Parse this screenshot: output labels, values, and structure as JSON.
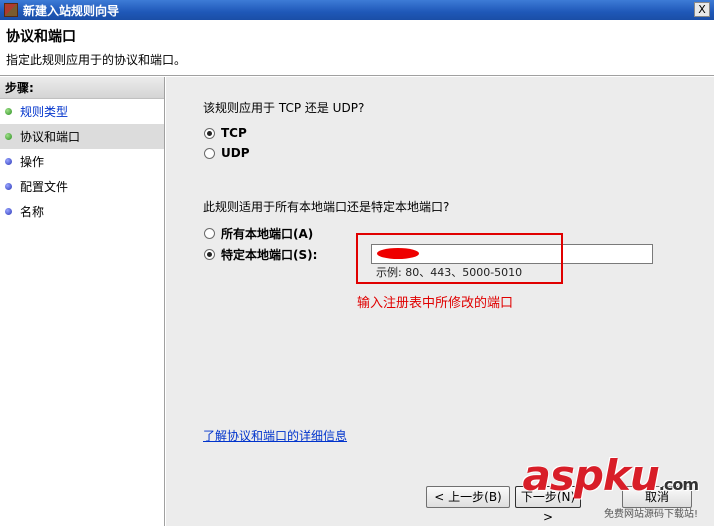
{
  "window": {
    "title": "新建入站规则向导",
    "close_label": "X"
  },
  "header": {
    "title": "协议和端口",
    "subtitle": "指定此规则应用于的协议和端口。"
  },
  "sidebar": {
    "heading": "步骤:",
    "items": [
      {
        "label": "规则类型",
        "status": "done"
      },
      {
        "label": "协议和端口",
        "status": "current"
      },
      {
        "label": "操作",
        "status": "pending"
      },
      {
        "label": "配置文件",
        "status": "pending"
      },
      {
        "label": "名称",
        "status": "pending"
      }
    ]
  },
  "protocol": {
    "question": "该规则应用于 TCP 还是 UDP?",
    "options": [
      {
        "label": "TCP",
        "checked": true
      },
      {
        "label": "UDP",
        "checked": false
      }
    ]
  },
  "ports": {
    "question": "此规则适用于所有本地端口还是特定本地端口?",
    "options": [
      {
        "label": "所有本地端口(A)",
        "checked": false
      },
      {
        "label": "特定本地端口(S):",
        "checked": true
      }
    ],
    "input_value": "",
    "example": "示例: 80、443、5000-5010"
  },
  "annotation": "输入注册表中所修改的端口",
  "learn_more": "了解协议和端口的详细信息",
  "buttons": {
    "back": "< 上一步(B)",
    "next": "下一步(N) >",
    "cancel": "取消"
  },
  "watermark": {
    "logo": "aspku",
    "suffix": ".com",
    "sub": "免费网站源码下载站!"
  },
  "colors": {
    "annotation": "#e00000",
    "link": "#0033cc",
    "titlebar": "#1f58b8"
  }
}
